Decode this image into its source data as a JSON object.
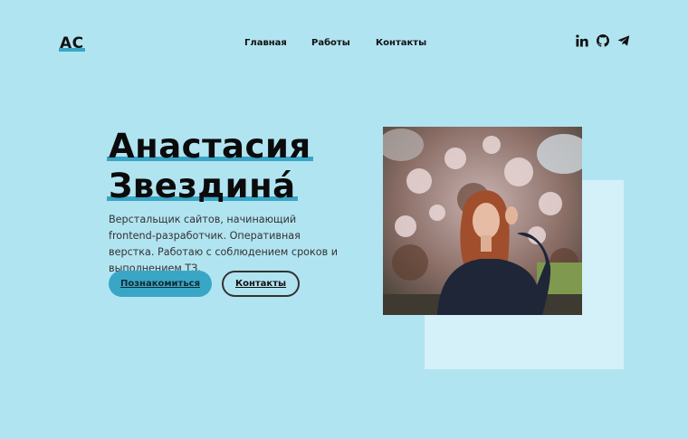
{
  "header": {
    "logo": "AC",
    "nav": [
      "Главная",
      "Работы",
      "Контакты"
    ],
    "social": [
      "linkedin-icon",
      "github-icon",
      "telegram-icon"
    ]
  },
  "hero": {
    "name_line1": "Анастасия",
    "name_line2": "Звездина́",
    "description": "Верстальщик сайтов, начинающий frontend-разработчик. Оперативная верстка. Работаю с соблюдением сроков и выполнением ТЗ.",
    "primary_button": "Познакомиться",
    "secondary_button": "Контакты"
  },
  "colors": {
    "background": "#b1e4f1",
    "accent": "#3aa6c6",
    "photo_backdrop": "#d4f0f8"
  }
}
